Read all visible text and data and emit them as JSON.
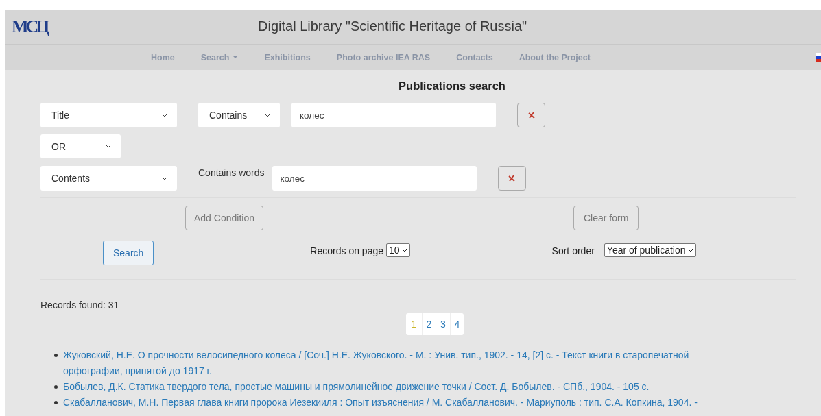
{
  "header": {
    "logo": "МСЦ",
    "title": "Digital Library \"Scientific Heritage of Russia\""
  },
  "nav": [
    {
      "label": "Home",
      "dropdown": false
    },
    {
      "label": "Search",
      "dropdown": true
    },
    {
      "label": "Exhibitions",
      "dropdown": false
    },
    {
      "label": "Photo archive IEA RAS",
      "dropdown": false
    },
    {
      "label": "Contacts",
      "dropdown": false
    },
    {
      "label": "About the Project",
      "dropdown": false
    }
  ],
  "form": {
    "title": "Publications search",
    "conditions": [
      {
        "field": "Title",
        "kind": "select",
        "operator": "Contains",
        "value": "колес"
      },
      {
        "field": "Contents",
        "kind": "label",
        "operator": "Contains words",
        "value": "колес"
      }
    ],
    "joiner": "OR",
    "add_button": "Add Condition",
    "clear_button": "Clear form",
    "search_button": "Search",
    "records_label": "Records on page",
    "records_value": "10",
    "sort_label": "Sort order",
    "sort_value": "Year of publication"
  },
  "results": {
    "found": "Records found: 31",
    "pages": [
      {
        "label": "1",
        "selected": true
      },
      {
        "label": "2",
        "selected": false
      },
      {
        "label": "3",
        "selected": false
      },
      {
        "label": "4",
        "selected": false
      }
    ],
    "items": [
      "Жуковский, Н.Е. О прочности велосипедного колеса / [Соч.] Н.Е. Жуковского. - М. : Унив. тип., 1902. - 14, [2] с. - Текст книги в старопечатной орфографии, принятой до 1917 г.",
      "Бобылев, Д.К. Статика твердого тела, простые машины и прямолинейное движение точки / Сост. Д. Бобылев. - СПб., 1904. - 105 с.",
      "Скабалланович, М.Н. Первая глава книги пророка Иезекииля : Опыт изъяснения / М. Скабалланович. - Мариуполь : тип. С.А. Копкина, 1904. -"
    ]
  }
}
